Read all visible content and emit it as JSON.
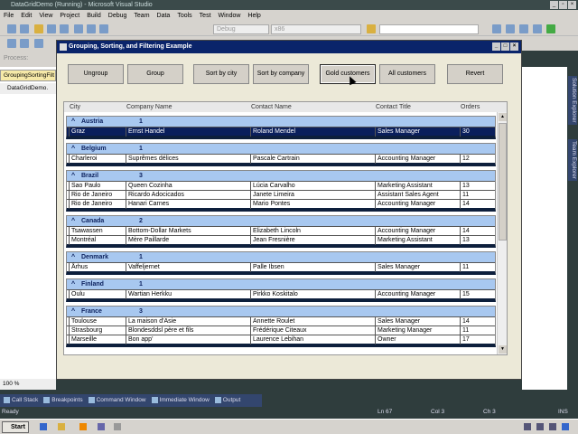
{
  "vs": {
    "title": "DataGridDemo (Running) - Microsoft Visual Studio",
    "menu": [
      "File",
      "Edit",
      "View",
      "Project",
      "Build",
      "Debug",
      "Team",
      "Data",
      "Tools",
      "Test",
      "Window",
      "Help"
    ],
    "config": "Debug",
    "platform": "x86",
    "process_label": "Process:",
    "doc_tab": "GroupingSortingFilt",
    "code_file": "DataGridDemo.",
    "zoom": "100 %",
    "side_tabs": [
      "Solution Explorer",
      "Team Explorer"
    ],
    "bottom_tabs": [
      "Call Stack",
      "Breakpoints",
      "Command Window",
      "Immediate Window",
      "Output"
    ],
    "status": {
      "text": "Ready",
      "ln": "Ln 67",
      "col": "Col 3",
      "ch": "Ch 3",
      "mode": "INS"
    },
    "start": "Start"
  },
  "dialog": {
    "title": "Grouping, Sorting, and Filtering Example",
    "buttons": [
      "Ungroup",
      "Group",
      "Sort by city",
      "Sort by company",
      "Gold customers",
      "All customers",
      "Revert"
    ],
    "columns": [
      "City",
      "Company Name",
      "Contact Name",
      "Contact Title",
      "Orders"
    ],
    "groups": [
      {
        "name": "Austria",
        "count": "1",
        "rows": [
          [
            "Graz",
            "Ernst Handel",
            "Roland Mendel",
            "Sales Manager",
            "30"
          ]
        ]
      },
      {
        "name": "Belgium",
        "count": "1",
        "rows": [
          [
            "Charleroi",
            "Suprêmes délices",
            "Pascale Cartrain",
            "Accounting Manager",
            "12"
          ]
        ]
      },
      {
        "name": "Brazil",
        "count": "3",
        "rows": [
          [
            "Sao Paulo",
            "Queen Cozinha",
            "Lúcia Carvalho",
            "Marketing Assistant",
            "13"
          ],
          [
            "Rio de Janeiro",
            "Ricardo Adocicados",
            "Janete Limeira",
            "Assistant Sales Agent",
            "11"
          ],
          [
            "Rio de Janeiro",
            "Hanari Carnes",
            "Mario Pontes",
            "Accounting Manager",
            "14"
          ]
        ]
      },
      {
        "name": "Canada",
        "count": "2",
        "rows": [
          [
            "Tsawassen",
            "Bottom-Dollar Markets",
            "Elizabeth Lincoln",
            "Accounting Manager",
            "14"
          ],
          [
            "Montréal",
            "Mère Paillarde",
            "Jean Fresnière",
            "Marketing Assistant",
            "13"
          ]
        ]
      },
      {
        "name": "Denmark",
        "count": "1",
        "rows": [
          [
            "Århus",
            "Vaffeljernet",
            "Palle Ibsen",
            "Sales Manager",
            "11"
          ]
        ]
      },
      {
        "name": "Finland",
        "count": "1",
        "rows": [
          [
            "Oulu",
            "Wartian Herkku",
            "Pirkko Koskitalo",
            "Accounting Manager",
            "15"
          ]
        ]
      },
      {
        "name": "France",
        "count": "3",
        "rows": [
          [
            "Toulouse",
            "La maison d'Asie",
            "Annette Roulet",
            "Sales Manager",
            "14"
          ],
          [
            "Strasbourg",
            "Blondesddsl père et fils",
            "Frédérique Citeaux",
            "Marketing Manager",
            "11"
          ],
          [
            "Marseille",
            "Bon app'",
            "Laurence Lebihan",
            "Owner",
            "17"
          ]
        ]
      }
    ]
  }
}
